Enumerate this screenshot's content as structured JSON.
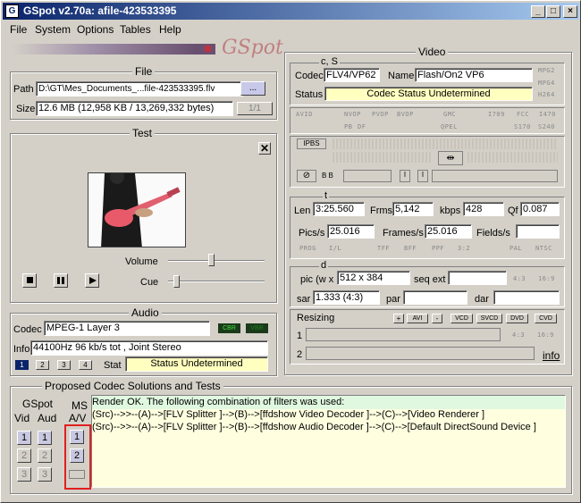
{
  "window": {
    "title": "GSpot v2.70a: afile-423533395",
    "min": "_",
    "max": "□",
    "close": "×"
  },
  "menu": [
    "File",
    "System",
    "Options",
    "Tables",
    "Help"
  ],
  "logo": "GSpot",
  "file": {
    "group": "File",
    "path_label": "Path",
    "path": "D:\\GT\\Mes_Documents_...file-423533395.flv",
    "browse": "...",
    "size_label": "Size",
    "size": "12.6 MB (12,958 KB / 13,269,332 bytes)",
    "part": "1/1"
  },
  "test": {
    "group": "Test",
    "volume": "Volume",
    "cue": "Cue",
    "volume_level": 0.45,
    "cue_level": 0.02
  },
  "audio": {
    "group": "Audio",
    "codec_label": "Codec",
    "codec": "MPEG-1 Layer 3",
    "cbr": "CBR",
    "vbr": "VBR",
    "info_label": "Info",
    "info": "44100Hz  96 kb/s tot , Joint Stereo",
    "streams": [
      "1",
      "2",
      "3",
      "4"
    ],
    "stat_label": "Stat",
    "stat": "Status Undetermined"
  },
  "video": {
    "group": "Video",
    "cs": "c, S",
    "codec_label": "Codec",
    "codec": "FLV4/VP62",
    "name_label": "Name",
    "name": "Flash/On2 VP6",
    "status_label": "Status",
    "status": "Codec Status Undetermined",
    "mpg2": "MPG2",
    "mpg4": "MPG4",
    "h264": "H264",
    "flags1": [
      "AVID",
      "NVOP",
      "PVOP",
      "BVOP",
      "GMC",
      "I709",
      "FCC",
      "I470"
    ],
    "flags2": [
      "PB",
      "DF",
      "QPEL",
      "S170",
      "S240"
    ],
    "ipbs": "IPBS",
    "bb": "B B",
    "t": "t",
    "len_label": "Len",
    "len": "3:25.560",
    "frms_label": "Frms",
    "frms": "5,142",
    "kbps_label": "kbps",
    "kbps": "428",
    "qf_label": "Qf",
    "qf": "0.087",
    "pics_label": "Pics/s",
    "pics": "25.016",
    "frames_label": "Frames/s",
    "frames": "25.016",
    "fields_label": "Fields/s",
    "fields": "",
    "flags3": [
      "PROG",
      "I/L",
      "TFF",
      "BFF",
      "PPF",
      "3:2",
      "PAL",
      "NTSC"
    ],
    "d": "d",
    "pic_label": "pic (w x",
    "pic": "512 x 384",
    "seqext_label": "seq ext",
    "r43": "4:3",
    "r169": "16:9",
    "sar_label": "sar",
    "sar": "1.333 (4:3)",
    "par_label": "par",
    "dar_label": "dar",
    "resizing": "Resizing",
    "rbtns": [
      "+",
      "AVI",
      "-",
      "VCD",
      "SVCD",
      "DVD",
      "CVD"
    ],
    "r1": "1",
    "r2": "2",
    "r43b": "4:3",
    "r169b": "16:9",
    "info_link": "info"
  },
  "proposed": {
    "group": "Proposed Codec Solutions and Tests",
    "gspot": "GSpot",
    "vid": "Vid",
    "aud": "Aud",
    "ms": "MS",
    "av": "A/V",
    "lines": [
      "Render OK. The following combination of filters was used:",
      "(Src)-->>--(A)-->[FLV Splitter ]-->(B)-->[ffdshow Video Decoder ]-->(C)-->[Video Renderer ]",
      "(Src)-->>--(A)-->[FLV Splitter ]-->(B)-->[ffdshow Audio Decoder ]-->(C)-->[Default DirectSound Device ]"
    ]
  }
}
